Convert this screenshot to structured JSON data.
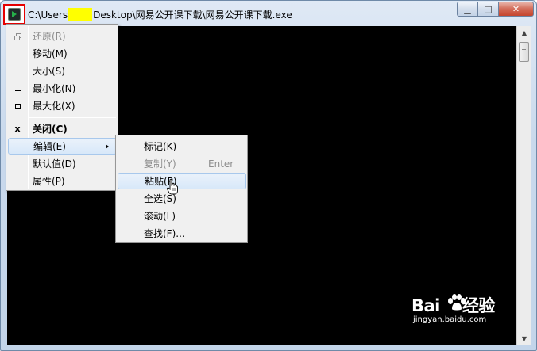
{
  "window": {
    "title_before": "C:\\Users",
    "title_after": "Desktop\\网易公开课下载\\网易公开课下载.exe",
    "minimize_glyph": "▁",
    "maximize_glyph": "□",
    "close_glyph": "✕"
  },
  "system_menu": {
    "items": [
      {
        "label": "还原(R)",
        "icon": "restore-icon"
      },
      {
        "label": "移动(M)"
      },
      {
        "label": "大小(S)"
      },
      {
        "label": "最小化(N)",
        "icon": "minimize-icon"
      },
      {
        "label": "最大化(X)",
        "icon": "maximize-icon"
      },
      {
        "label": "关闭(C)",
        "icon": "close-icon",
        "icon_glyph": "x"
      },
      {
        "label": "编辑(E)",
        "icon": "submenu-arrow-icon"
      },
      {
        "label": "默认值(D)"
      },
      {
        "label": "属性(P)"
      }
    ]
  },
  "edit_menu": {
    "items": [
      {
        "label": "标记(K)"
      },
      {
        "label": "复制(Y)",
        "shortcut": "Enter"
      },
      {
        "label": "粘贴(P)"
      },
      {
        "label": "全选(S)"
      },
      {
        "label": "滚动(L)"
      },
      {
        "label": "查找(F)..."
      }
    ]
  },
  "watermark": {
    "logo_left": "Bai",
    "logo_right": "经验",
    "url": "jingyan.baidu.com"
  },
  "colors": {
    "console_bg": "#000000",
    "highlight": "#d8e8f9",
    "annotation_red": "#e60000",
    "mask_yellow": "#ffff00"
  }
}
